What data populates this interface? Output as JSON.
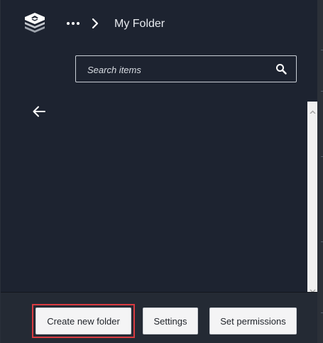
{
  "header": {
    "breadcrumb_current": "My Folder",
    "logo_icon": "stacked-layers-logo",
    "more_icon": "ellipsis-icon",
    "separator_icon": "chevron-right-icon"
  },
  "search": {
    "placeholder": "Search items",
    "value": "",
    "icon": "search-icon"
  },
  "navigation": {
    "back_icon": "arrow-left-icon"
  },
  "footer": {
    "create_label": "Create new folder",
    "settings_label": "Settings",
    "permissions_label": "Set permissions"
  },
  "colors": {
    "background": "#1d2330",
    "footer_background": "#242a34",
    "focus_outline": "#d93b41",
    "button_background": "#f4f4f5",
    "text_light": "#e8ebef"
  }
}
